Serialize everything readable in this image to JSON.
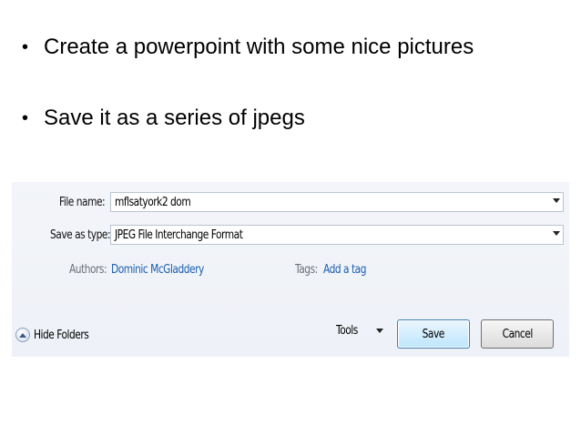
{
  "slide": {
    "bullets": [
      "Create a powerpoint with some nice pictures",
      "Save it as a series of jpegs"
    ]
  },
  "dialog": {
    "file_name_label": "File name:",
    "file_name_value": "mflsatyork2 dom",
    "save_as_type_label": "Save as type:",
    "save_as_type_value": "JPEG File Interchange Format",
    "authors_label": "Authors:",
    "authors_value": "Dominic McGladdery",
    "tags_label": "Tags:",
    "tags_value": "Add a tag",
    "hide_folders_label": "Hide Folders",
    "tools_label": "Tools",
    "save_label": "Save",
    "cancel_label": "Cancel"
  },
  "icons": {
    "bullet": "bullet-dot",
    "dropdown": "chevron-down-icon",
    "hide_folders": "chevron-up-circle-icon"
  },
  "colors": {
    "link": "#1c5fb0",
    "meta_label": "#6a6f76",
    "save_button_border": "#3c7fb1"
  }
}
